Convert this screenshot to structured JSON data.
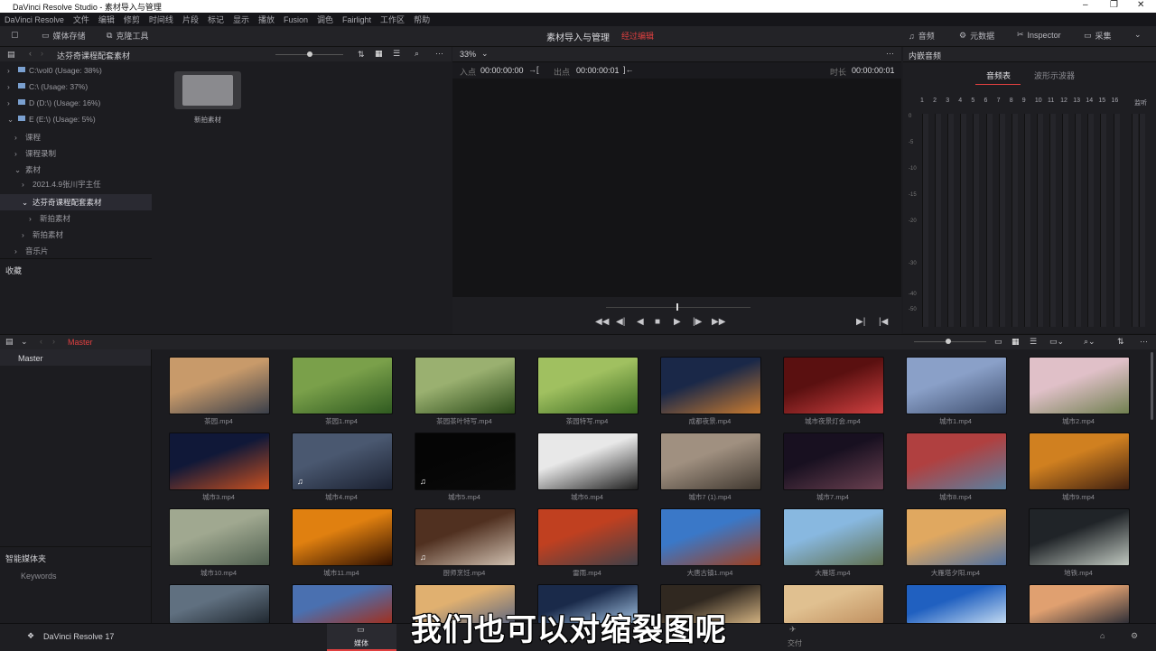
{
  "window": {
    "title": "DaVinci Resolve Studio - 素材导入与管理"
  },
  "menu": [
    "DaVinci Resolve",
    "文件",
    "编辑",
    "修剪",
    "时间线",
    "片段",
    "标记",
    "显示",
    "播放",
    "Fusion",
    "调色",
    "Fairlight",
    "工作区",
    "帮助"
  ],
  "toolbar": {
    "media_pool": "媒体存储",
    "clone_tool": "克隆工具",
    "project_title": "素材导入与管理",
    "unsaved": "经过编辑",
    "audio": "音频",
    "metadata": "元数据",
    "inspector": "Inspector",
    "capture": "采集"
  },
  "storage": {
    "path": "达芬奇课程配套素材",
    "zoom": "33%",
    "items": [
      "C:\\vol0 (Usage: 38%)",
      "C:\\ (Usage: 37%)",
      "D (D:\\) (Usage: 16%)",
      "E (E:\\) (Usage: 5%)",
      "课程",
      "课程录制",
      "素材",
      "2021.4.9张川宇主任",
      "达芬奇课程配套素材",
      "新拍素材",
      "新拍素材",
      "音乐片"
    ],
    "favorites": "收藏",
    "folder_name": "新拍素材"
  },
  "viewer": {
    "in_label": "入点",
    "in_tc": "00:00:00:00",
    "out_label": "出点",
    "out_tc": "00:00:00:01",
    "dur_label": "时长",
    "dur_tc": "00:00:00:01"
  },
  "audio": {
    "title": "内嵌音频",
    "tab_meters": "音频表",
    "tab_waveform": "波形示波器",
    "channels": [
      "1",
      "2",
      "3",
      "4",
      "5",
      "6",
      "7",
      "8",
      "9",
      "10",
      "11",
      "12",
      "13",
      "14",
      "15",
      "16"
    ],
    "monitor": "监听",
    "scale": [
      "0",
      "-5",
      "-10",
      "-15",
      "-20",
      "-30",
      "-40",
      "-50"
    ]
  },
  "pool": {
    "bin": "Master",
    "master_item": "Master",
    "smart_bins": "智能媒体夹",
    "keywords": "Keywords",
    "clips": [
      {
        "name": "茶园.mp4",
        "c1": "#c89a6a",
        "c2": "#3a3f4a"
      },
      {
        "name": "茶园1.mp4",
        "c1": "#7aa04a",
        "c2": "#2f5a20"
      },
      {
        "name": "茶园茶叶特写.mp4",
        "c1": "#9ab070",
        "c2": "#2a4a18"
      },
      {
        "name": "茶园特写.mp4",
        "c1": "#a0c060",
        "c2": "#3a6a20"
      },
      {
        "name": "成都夜景.mp4",
        "c1": "#1a2848",
        "c2": "#c87a30"
      },
      {
        "name": "城市夜景灯会.mp4",
        "c1": "#5a1010",
        "c2": "#d04040"
      },
      {
        "name": "城市1.mp4",
        "c1": "#8aa0c8",
        "c2": "#405070"
      },
      {
        "name": "城市2.mp4",
        "c1": "#e0c0c8",
        "c2": "#708050"
      },
      {
        "name": "城市3.mp4",
        "c1": "#101838",
        "c2": "#c85020"
      },
      {
        "name": "城市4.mp4",
        "c1": "#4a5870",
        "c2": "#1a2030"
      },
      {
        "name": "城市5.mp4",
        "c1": "#050505",
        "c2": "#0a0a0a"
      },
      {
        "name": "城市6.mp4",
        "c1": "#e8e8e8",
        "c2": "#202020"
      },
      {
        "name": "城市7 (1).mp4",
        "c1": "#a09080",
        "c2": "#403830"
      },
      {
        "name": "城市7.mp4",
        "c1": "#181020",
        "c2": "#6a4050"
      },
      {
        "name": "城市8.mp4",
        "c1": "#b04040",
        "c2": "#5a80a0"
      },
      {
        "name": "城市9.mp4",
        "c1": "#d08020",
        "c2": "#402010"
      },
      {
        "name": "城市10.mp4",
        "c1": "#a0a890",
        "c2": "#506050"
      },
      {
        "name": "城市11.mp4",
        "c1": "#e08010",
        "c2": "#301000"
      },
      {
        "name": "厨师烹饪.mp4",
        "c1": "#503020",
        "c2": "#d0c0b0"
      },
      {
        "name": "雷雨.mp4",
        "c1": "#c04020",
        "c2": "#404048"
      },
      {
        "name": "大唐古镇1.mp4",
        "c1": "#3a78c8",
        "c2": "#a04020"
      },
      {
        "name": "大雁塔.mp4",
        "c1": "#88b8e0",
        "c2": "#607050"
      },
      {
        "name": "大雁塔夕阳.mp4",
        "c1": "#e0a860",
        "c2": "#5070a0"
      },
      {
        "name": "地铁.mp4",
        "c1": "#202428",
        "c2": "#c0c8c0"
      },
      {
        "name": "",
        "c1": "#607080",
        "c2": "#202830"
      },
      {
        "name": "",
        "c1": "#4a70b0",
        "c2": "#a03020"
      },
      {
        "name": "",
        "c1": "#e0b070",
        "c2": "#606880"
      },
      {
        "name": "",
        "c1": "#1a2a4a",
        "c2": "#a0c0e0"
      },
      {
        "name": "",
        "c1": "#302820",
        "c2": "#d0b080"
      },
      {
        "name": "",
        "c1": "#e0c090",
        "c2": "#c09060"
      },
      {
        "name": "",
        "c1": "#2060c0",
        "c2": "#c0d8f0"
      },
      {
        "name": "",
        "c1": "#e0a070",
        "c2": "#303038"
      }
    ]
  },
  "bottom": {
    "app": "DaVinci Resolve 17",
    "media_tab": "媒体",
    "deliver_tab": "交付"
  },
  "subtitle": "我们也可以对缩裂图呢",
  "colors": {
    "accent": "#e04040",
    "panel": "#1c1c20"
  }
}
